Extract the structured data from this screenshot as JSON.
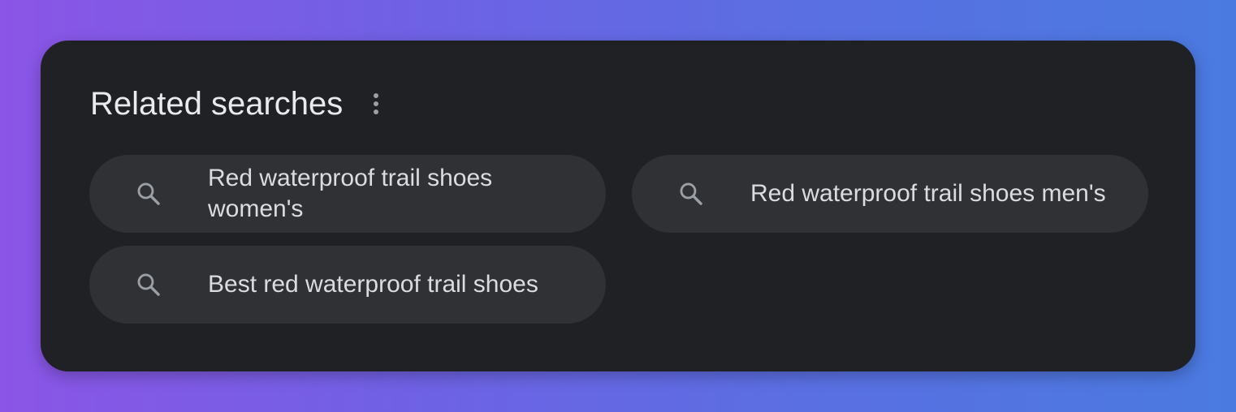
{
  "panel": {
    "title": "Related searches",
    "menu_icon": "more-vert-icon"
  },
  "chips": [
    {
      "label": "Red waterproof trail shoes women's",
      "icon": "search-icon"
    },
    {
      "label": "Red waterproof trail shoes men's",
      "icon": "search-icon"
    },
    {
      "label": "Best red waterproof trail shoes",
      "icon": "search-icon"
    }
  ],
  "colors": {
    "card_bg": "#202124",
    "chip_bg": "#303134",
    "title_text": "#e8eaed",
    "chip_text": "#dadce0",
    "icon": "#9aa0a6"
  }
}
